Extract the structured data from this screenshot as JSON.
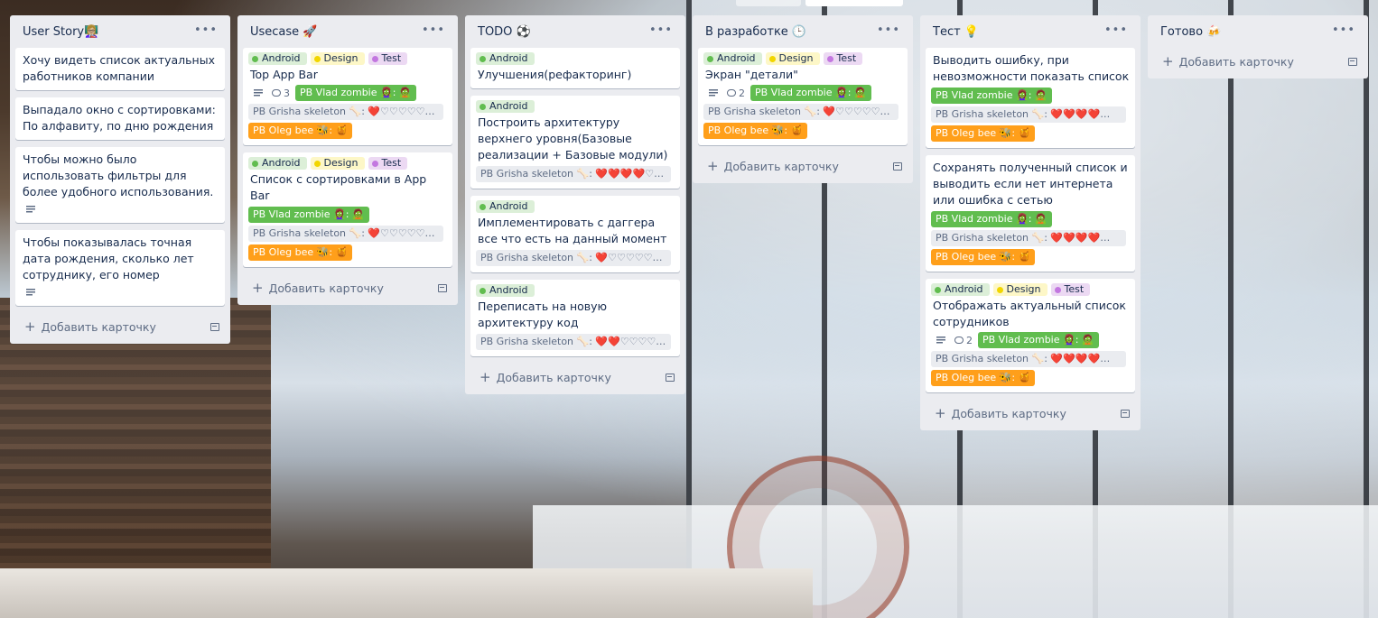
{
  "add_card_label": "Добавить карточку",
  "lists": [
    {
      "title": "User Story👩🏼‍🏫",
      "cards": [
        {
          "title": "Хочу видеть список актуальных работников компании",
          "labels": [],
          "desc": false,
          "comments": "",
          "fields": []
        },
        {
          "title": "Выпадало окно с сортировками: По алфавиту, по дню рождения",
          "labels": [],
          "desc": false,
          "comments": "",
          "fields": []
        },
        {
          "title": "Чтобы можно было использовать фильтры для более удобного использования.",
          "labels": [],
          "desc": true,
          "comments": "",
          "fields": []
        },
        {
          "title": "Чтобы показывалась точная дата рождения, сколько лет сотруднику, его номер",
          "labels": [],
          "desc": true,
          "comments": "",
          "fields": []
        }
      ]
    },
    {
      "title": "Usecase 🚀",
      "cards": [
        {
          "title": "Top App Bar",
          "labels": [
            "Android",
            "Design",
            "Test"
          ],
          "desc": true,
          "comments": "3",
          "fields": [
            {
              "text": "PB Vlad zombie 🧟‍♀️: 🧟",
              "color": "green",
              "inline": true
            },
            {
              "text": "PB Grisha skeleton 🦴: ❤️♡♡♡♡♡♡♡♡♡",
              "color": "grey"
            },
            {
              "text": "PB Oleg bee 🐝: 🍯",
              "color": "orange"
            }
          ]
        },
        {
          "title": "Список с сортировками в App Bar",
          "labels": [
            "Android",
            "Design",
            "Test"
          ],
          "desc": false,
          "comments": "",
          "fields": [
            {
              "text": "PB Vlad zombie 🧟‍♀️: 🧟",
              "color": "green"
            },
            {
              "text": "PB Grisha skeleton 🦴: ❤️♡♡♡♡♡♡♡♡♡",
              "color": "grey"
            },
            {
              "text": "PB Oleg bee 🐝: 🍯",
              "color": "orange"
            }
          ]
        }
      ]
    },
    {
      "title": "TODO ⚽",
      "cards": [
        {
          "title": "Улучшения(рефакторинг)",
          "labels": [
            "Android"
          ],
          "desc": false,
          "comments": "",
          "fields": []
        },
        {
          "title": "Построить архитектуру верхнего уровня(Базовые реализации + Базовые модули)",
          "labels": [
            "Android"
          ],
          "desc": false,
          "comments": "",
          "fields": [
            {
              "text": "PB Grisha skeleton 🦴: ❤️❤️❤️❤️♡♡♡♡♡♡",
              "color": "grey"
            }
          ]
        },
        {
          "title": "Имплементировать с даггера все что есть на данный момент",
          "labels": [
            "Android"
          ],
          "desc": false,
          "comments": "",
          "fields": [
            {
              "text": "PB Grisha skeleton 🦴: ❤️♡♡♡♡♡♡♡♡♡",
              "color": "grey"
            }
          ]
        },
        {
          "title": "Переписать на новую архитектуру код",
          "labels": [
            "Android"
          ],
          "desc": false,
          "comments": "",
          "fields": [
            {
              "text": "PB Grisha skeleton 🦴: ❤️❤️♡♡♡♡♡♡♡♡",
              "color": "grey"
            }
          ]
        }
      ]
    },
    {
      "title": "В разработке 🕒",
      "cards": [
        {
          "title": "Экран \"детали\"",
          "labels": [
            "Android",
            "Design",
            "Test"
          ],
          "desc": true,
          "comments": "2",
          "fields": [
            {
              "text": "PB Vlad zombie 🧟‍♀️: 🧟",
              "color": "green",
              "inline": true
            },
            {
              "text": "PB Grisha skeleton 🦴: ❤️♡♡♡♡♡♡♡♡♡",
              "color": "grey"
            },
            {
              "text": "PB Oleg bee 🐝: 🍯",
              "color": "orange"
            }
          ]
        }
      ]
    },
    {
      "title": "Тест 💡",
      "cards": [
        {
          "title": "Выводить ошибку, при невозможности показать список",
          "labels": [],
          "desc": false,
          "comments": "",
          "fields": [
            {
              "text": "PB Vlad zombie 🧟‍♀️: 🧟",
              "color": "green"
            },
            {
              "text": "PB Grisha skeleton 🦴: ❤️❤️❤️❤️❤️♡♡♡♡♡",
              "color": "grey"
            },
            {
              "text": "PB Oleg bee 🐝: 🍯",
              "color": "orange"
            }
          ]
        },
        {
          "title": "Сохранять полученный список и выводить если нет интернета или ошибка с сетью",
          "labels": [],
          "desc": false,
          "comments": "",
          "fields": [
            {
              "text": "PB Vlad zombie 🧟‍♀️: 🧟",
              "color": "green"
            },
            {
              "text": "PB Grisha skeleton 🦴: ❤️❤️❤️❤️❤️♡♡♡♡♡",
              "color": "grey"
            },
            {
              "text": "PB Oleg bee 🐝: 🍯",
              "color": "orange"
            }
          ]
        },
        {
          "title": "Отображать актуальный список сотрудников",
          "labels": [
            "Android",
            "Design",
            "Test"
          ],
          "desc": true,
          "comments": "2",
          "fields": [
            {
              "text": "PB Vlad zombie 🧟‍♀️: 🧟",
              "color": "green",
              "inline": true
            },
            {
              "text": "PB Grisha skeleton 🦴: ❤️❤️❤️❤️❤️♡♡♡♡♡",
              "color": "grey"
            },
            {
              "text": "PB Oleg bee 🐝: 🍯",
              "color": "orange"
            }
          ]
        }
      ]
    },
    {
      "title": "Готово 🍻",
      "cards": []
    }
  ]
}
